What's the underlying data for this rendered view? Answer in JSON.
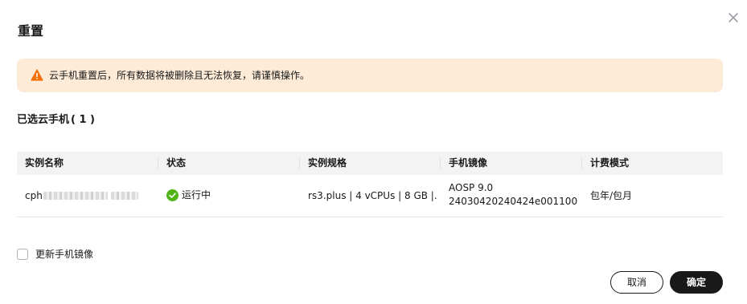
{
  "dialog": {
    "title": "重置",
    "warning": {
      "icon": "warning-triangle-icon",
      "text": "云手机重置后，所有数据将被删除且无法恢复，请谨慎操作。",
      "background_color": "#fdebd8",
      "icon_color": "#f66f06"
    },
    "selected": {
      "label": "已选云手机",
      "count_text": "( 1 )"
    },
    "table": {
      "columns": [
        "实例名称",
        "状态",
        "实例规格",
        "手机镜像",
        "计费模式"
      ],
      "rows": [
        {
          "name_prefix": "cph",
          "status": "运行中",
          "status_icon": "running-check-icon",
          "status_color": "#50b416",
          "spec": "rs3.plus | 4 vCPUs | 8 GB |...",
          "image_line1": "AOSP 9.0",
          "image_line2": "24030420240424e001100...",
          "billing": "包年/包月"
        }
      ]
    },
    "update_image_checkbox": {
      "label": "更新手机镜像",
      "checked": false
    },
    "buttons": {
      "cancel": "取消",
      "ok": "确定"
    }
  }
}
